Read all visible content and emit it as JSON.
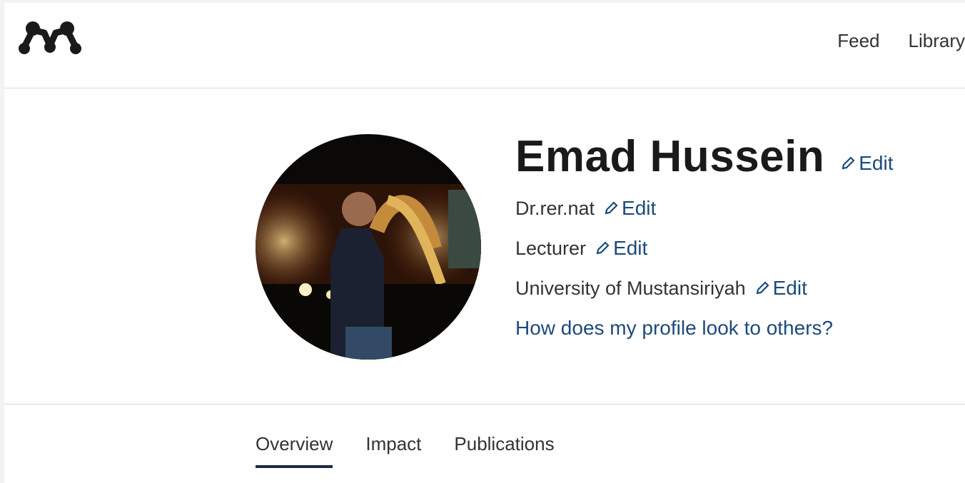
{
  "header": {
    "logo_name": "mendeley-logo",
    "nav": [
      {
        "label": "Feed"
      },
      {
        "label": "Library"
      }
    ]
  },
  "profile": {
    "name": "Emad Hussein",
    "edit_label": "Edit",
    "degree": "Dr.rer.nat",
    "position": "Lecturer",
    "institution": "University of Mustansiriyah",
    "preview_link": "How does my profile look to others?",
    "avatar_icon": "person-photo"
  },
  "tabs": [
    {
      "label": "Overview",
      "active": true
    },
    {
      "label": "Impact",
      "active": false
    },
    {
      "label": "Publications",
      "active": false
    }
  ],
  "colors": {
    "link": "#1d4a7a",
    "tab_underline": "#1b2b45",
    "divider": "#d9d9d9"
  }
}
